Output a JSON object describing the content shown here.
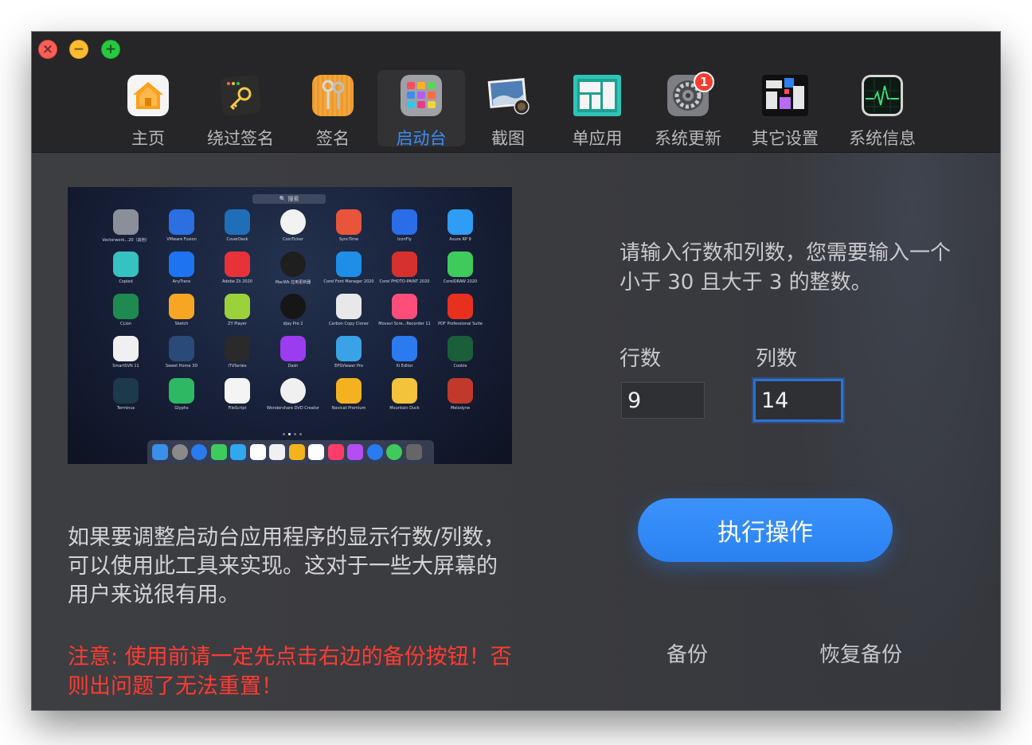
{
  "window": {
    "controls": {
      "close": "×",
      "minimize": "−",
      "maximize": "+"
    }
  },
  "tabs": [
    {
      "label": "主页",
      "icon": "home-icon"
    },
    {
      "label": "绕过签名",
      "icon": "key-bypass-icon"
    },
    {
      "label": "签名",
      "icon": "keychain-icon"
    },
    {
      "label": "启动台",
      "icon": "launchpad-icon",
      "active": true
    },
    {
      "label": "截图",
      "icon": "screenshot-icon"
    },
    {
      "label": "单应用",
      "icon": "single-app-icon"
    },
    {
      "label": "系统更新",
      "icon": "system-preferences-icon",
      "badge": "1"
    },
    {
      "label": "其它设置",
      "icon": "other-settings-icon"
    },
    {
      "label": "系统信息",
      "icon": "activity-monitor-icon"
    }
  ],
  "preview": {
    "search": "🔍 搜索",
    "apps": [
      "Vectorwork...20（其他）",
      "VMware Fusion",
      "CoverDesk",
      "CoinTicker",
      "SyncTime",
      "IconFly",
      "Axure RP 9",
      "Copied",
      "AnyTrans",
      "Adobe Zii 2020",
      "MacWk 应用更新器",
      "Corel Font Manager 2020",
      "Corel PHOTO-PAINT 2020",
      "CorelDRAW 2020",
      "CLion",
      "Sketch",
      "ZY Player",
      "djay Pro 2",
      "Carbon Copy Cloner",
      "Movavi Scre...Recorder 11",
      "PDF Professional Suite",
      "SmartSVN 11",
      "Sweet Home 3D",
      "iTVSeries",
      "Dash",
      "EPSViewer Pro",
      "Xi Editor",
      "Cookie",
      "Terminus",
      "Glyphs",
      "FileScript",
      "Wondershare DVD Creator",
      "Navicat Premium",
      "Mountain Duck",
      "Melodyne"
    ]
  },
  "description": "如果要调整启动台应用程序的显示行数/列数，可以使用此工具来实现。这对于一些大屏幕的用户来说很有用。",
  "warning": "注意: 使用前请一定先点击右边的备份按钮！否则出问题了无法重置！",
  "prompt": "请输入行数和列数，您需要输入一个小于 30 且大于 3 的整数。",
  "rows": {
    "label": "行数",
    "value": "9"
  },
  "cols": {
    "label": "列数",
    "value": "14"
  },
  "run_label": "执行操作",
  "backup_label": "备份",
  "restore_label": "恢复备份",
  "colors": {
    "accent": "#2a82f2",
    "warning": "#ff3b30",
    "active_tab": "#3b8df5"
  }
}
